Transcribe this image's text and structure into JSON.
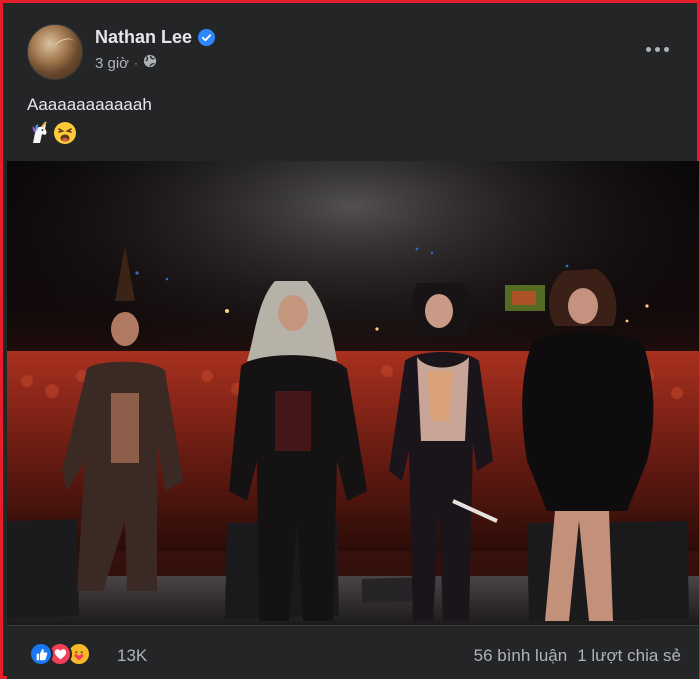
{
  "post": {
    "author": "Nathan Lee",
    "time": "3 giờ",
    "separator": "·",
    "text": "Aaaaaaaaaaaah",
    "emojis": [
      "unicorn-emoji",
      "weary-face-emoji"
    ]
  },
  "reactions": {
    "types": [
      "like-icon",
      "love-icon",
      "care-icon"
    ],
    "count": "13K",
    "comments": "56 bình luận",
    "shares": "1 lượt chia sẻ"
  },
  "colors": {
    "border": "#e41e2a",
    "card": "#242526",
    "text": "#e4e6eb",
    "muted": "#b0b3b8",
    "verified": "#2d88ff",
    "like": "#1877f2",
    "love": "#f33e58",
    "care": "#f7b928"
  }
}
